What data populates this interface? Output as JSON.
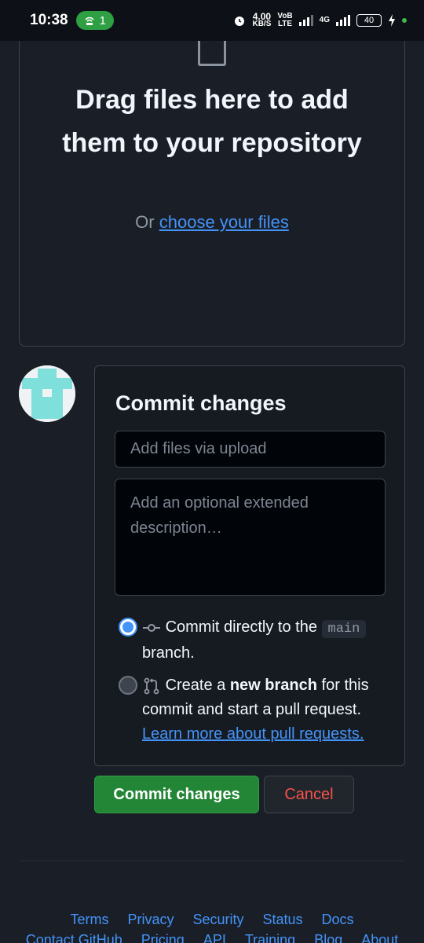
{
  "status_bar": {
    "time": "10:38",
    "hotspot_count": "1",
    "speed_value": "4.00",
    "speed_unit": "KB/S",
    "volte_top": "VoB",
    "volte_bottom": "LTE",
    "network": "4G",
    "battery": "40"
  },
  "dropzone": {
    "title": "Drag files here to add them to your repository",
    "or_text": "Or",
    "choose_link": "choose your files"
  },
  "commit": {
    "title": "Commit changes",
    "summary_placeholder": "Add files via upload",
    "description_placeholder": "Add an optional extended description…",
    "option_direct_text": "Commit directly to the",
    "option_direct_branch": "main",
    "option_direct_suffix": "branch.",
    "option_new_prefix": "Create a",
    "option_new_bold": "new branch",
    "option_new_suffix": "for this commit and start a pull request.",
    "learn_more": "Learn more about pull requests."
  },
  "buttons": {
    "commit": "Commit changes",
    "cancel": "Cancel"
  },
  "footer": {
    "row1": [
      "Terms",
      "Privacy",
      "Security",
      "Status",
      "Docs"
    ],
    "row2": [
      "Contact GitHub",
      "Pricing",
      "API",
      "Training",
      "Blog",
      "About"
    ]
  },
  "colors": {
    "accent_blue": "#4493f8",
    "commit_green": "#238636",
    "cancel_red": "#f85149",
    "avatar_teal": "#7fe0db"
  }
}
